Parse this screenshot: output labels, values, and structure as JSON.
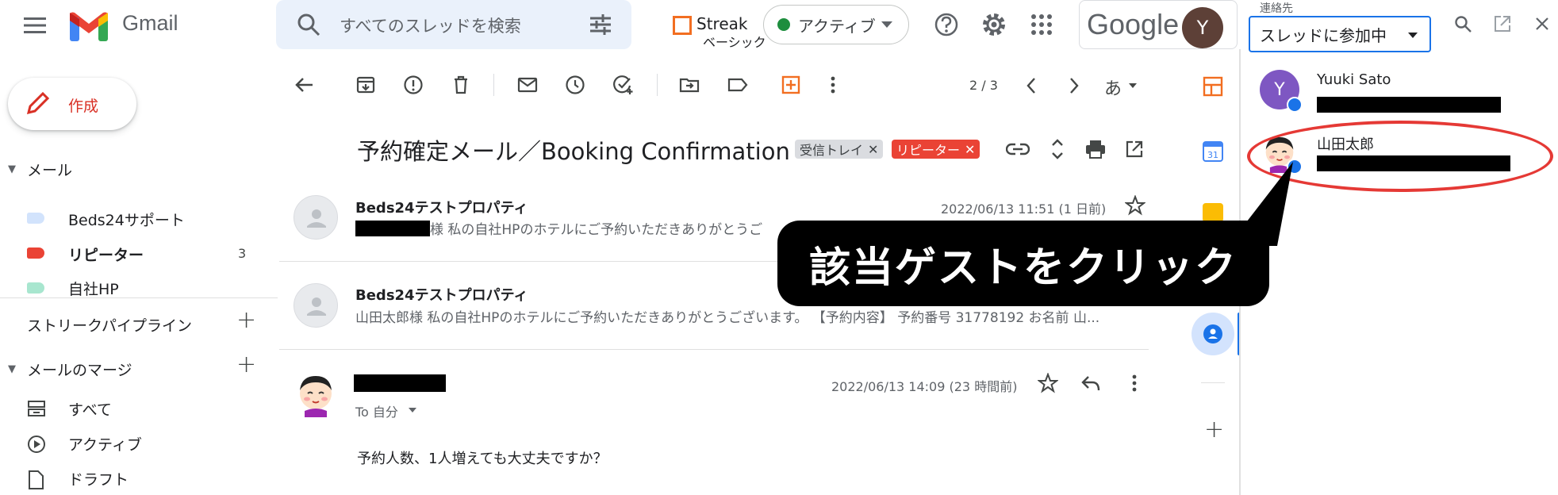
{
  "header": {
    "app_name": "Gmail",
    "search_placeholder": "すべてのスレッドを検索",
    "streak_label": "Streak",
    "streak_plan": "ベーシック",
    "status_label": "アクティブ",
    "google_label": "Google",
    "avatar_letter": "Y"
  },
  "sidebar": {
    "compose_label": "作成",
    "mail_section": "メール",
    "labels": [
      {
        "label": "Beds24サポート",
        "color": "#d2e3fc",
        "count": ""
      },
      {
        "label": "リピーター",
        "color": "#ea4335",
        "count": "3"
      },
      {
        "label": "自社HP",
        "color": "#a8e6cf",
        "count": ""
      }
    ],
    "streak_pipeline": "ストリークパイプライン",
    "mail_merge": "メールのマージ",
    "merge_items": [
      {
        "label": "すべて",
        "icon": "inbox-stack-icon"
      },
      {
        "label": "アクティブ",
        "icon": "play-circle-icon"
      },
      {
        "label": "ドラフト",
        "icon": "document-icon"
      }
    ]
  },
  "toolbar": {
    "page_indicator": "2 / 3",
    "ime_label": "あ"
  },
  "thread": {
    "subject": "予約確定メール／Booking Confirmation",
    "chips": [
      {
        "label": "受信トレイ",
        "bg": "#dadce0",
        "fg": "#3c4043"
      },
      {
        "label": "リピーター",
        "bg": "#ea4335",
        "fg": "#ffffff"
      }
    ],
    "messages": [
      {
        "sender": "Beds24テストプロパティ",
        "snippet": "様 私の自社HPのホテルにご予約いただきありがとうご",
        "date": "2022/06/13 11:51 (1 日前)"
      },
      {
        "sender": "Beds24テストプロパティ",
        "snippet": "山田太郎様 私の自社HPのホテルにご予約いただきありがとうございます。 【予約内容】 予約番号 31778192 お名前 山...",
        "date": ""
      },
      {
        "sender": "",
        "to_line": "To 自分",
        "date": "2022/06/13 14:09 (23 時間前)",
        "body": "予約人数、1人増えても大丈夫ですか？"
      }
    ]
  },
  "contacts_panel": {
    "title": "連絡先",
    "filter_label": "スレッドに参加中",
    "contacts": [
      {
        "name": "Yuuki Sato",
        "initial": "Y",
        "color": "#7e57c2"
      },
      {
        "name": "山田太郎",
        "initial": "",
        "color": "#ffffff"
      }
    ]
  },
  "annotation": {
    "callout_text": "該当ゲストをクリック"
  }
}
